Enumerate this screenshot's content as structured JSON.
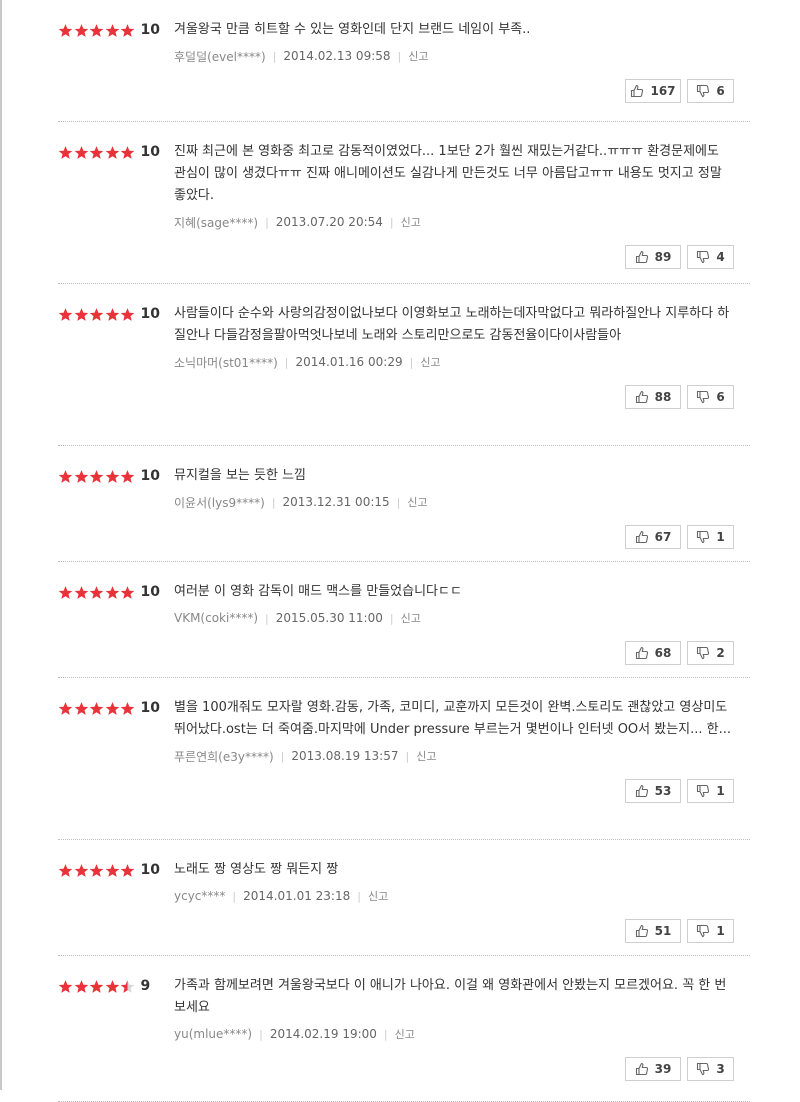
{
  "reviews": [
    {
      "score": "10",
      "stars": 5,
      "text": "겨울왕국 만큼 히트할 수 있는 영화인데 단지 브랜드 네임이 부족..",
      "user": "후덜덜(evel****)",
      "date": "2014.02.13 09:58",
      "report": "신고",
      "likes": "167",
      "dislikes": "6"
    },
    {
      "score": "10",
      "stars": 5,
      "text": "진짜 최근에 본 영화중 최고로 감동적이였었다... 1보단 2가 훨씬 재밌는거같다..ㅠㅠㅠ 환경문제에도 관심이 많이 생겼다ㅠㅠ 진짜 애니메이션도 실감나게 만든것도 너무 아름답고ㅠㅠ 내용도 멋지고 정말 좋았다.",
      "user": "지혜(sage****)",
      "date": "2013.07.20 20:54",
      "report": "신고",
      "likes": "89",
      "dislikes": "4"
    },
    {
      "score": "10",
      "stars": 5,
      "text": "사람들이다 순수와 사랑의감정이없나보다 이영화보고 노래하는데자막없다고 뭐라하질안나 지루하다 하질안나 다들감정을팔아먹엇나보네 노래와 스토리만으로도 감동전율이다이사람들아",
      "user": "소닉마머(st01****)",
      "date": "2014.01.16 00:29",
      "report": "신고",
      "likes": "88",
      "dislikes": "6"
    },
    {
      "score": "10",
      "stars": 5,
      "text": "뮤지컬을 보는 듯한 느낌",
      "user": "이윤서(lys9****)",
      "date": "2013.12.31 00:15",
      "report": "신고",
      "likes": "67",
      "dislikes": "1"
    },
    {
      "score": "10",
      "stars": 5,
      "text": "여러분 이 영화 감독이 매드 맥스를 만들었습니다ㄷㄷ",
      "user": "VKM(coki****)",
      "date": "2015.05.30 11:00",
      "report": "신고",
      "likes": "68",
      "dislikes": "2"
    },
    {
      "score": "10",
      "stars": 5,
      "text": "별을 100개줘도 모자랄 영화.감동, 가족, 코미디, 교훈까지 모든것이 완벽.스토리도 괜찮았고 영상미도 뛰어났다.ost는 더 죽여줌.마지막에 Under pressure 부르는거 몇번이나 인터넷 OO서 봤는지... 한...",
      "user": "푸른연희(e3y****)",
      "date": "2013.08.19 13:57",
      "report": "신고",
      "likes": "53",
      "dislikes": "1"
    },
    {
      "score": "10",
      "stars": 5,
      "text": "노래도 짱 영상도 짱 뭐든지 짱",
      "user": "ycyc****",
      "date": "2014.01.01 23:18",
      "report": "신고",
      "likes": "51",
      "dislikes": "1"
    },
    {
      "score": "9",
      "stars": 4.5,
      "text": "가족과 함께보려면 겨울왕국보다 이 애니가 나아요. 이걸 왜 영화관에서 안봤는지 모르겠어요. 꼭 한 번 보세요",
      "user": "yu(mlue****)",
      "date": "2014.02.19 19:00",
      "report": "신고",
      "likes": "39",
      "dislikes": "3"
    }
  ],
  "colors": {
    "star": "#e8333b",
    "star_empty": "#d6d6d6"
  }
}
